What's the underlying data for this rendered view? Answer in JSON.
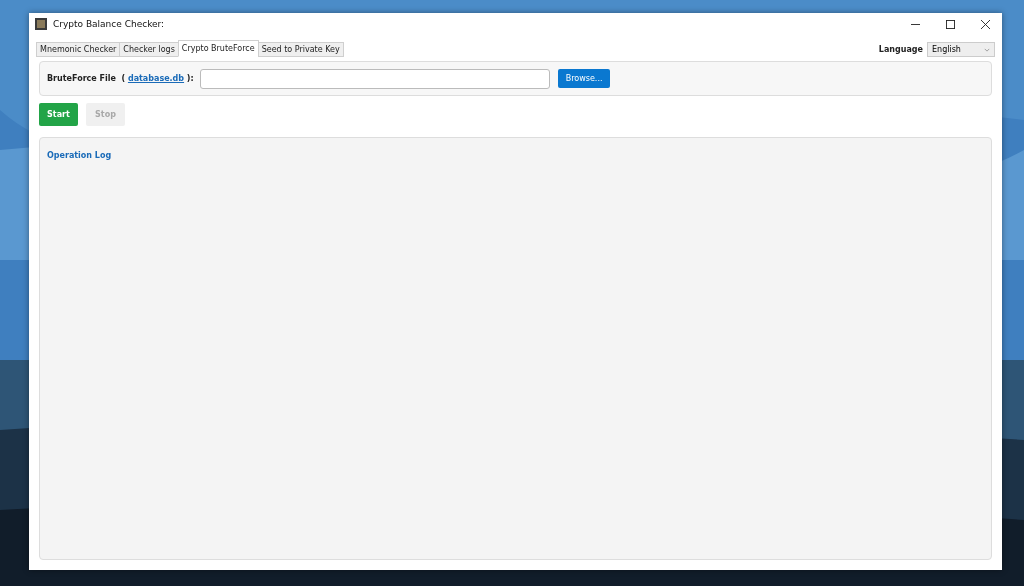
{
  "window": {
    "title": "Crypto Balance Checker:"
  },
  "tabs": [
    {
      "label": "Mnemonic Checker",
      "selected": false
    },
    {
      "label": "Checker logs",
      "selected": false
    },
    {
      "label": "Crypto BruteForce",
      "selected": true
    },
    {
      "label": "Seed to Private Key",
      "selected": false
    }
  ],
  "language": {
    "label": "Language",
    "value": "English"
  },
  "file": {
    "label": "BruteForce File",
    "open": "(",
    "link": "database.db",
    "close": "):",
    "browse": "Browse..."
  },
  "buttons": [
    {
      "label": "Start",
      "kind": "primary",
      "disabled": false
    },
    {
      "label": "Stop",
      "kind": "secondary",
      "disabled": true
    }
  ],
  "log": {
    "title": "Operation Log"
  }
}
